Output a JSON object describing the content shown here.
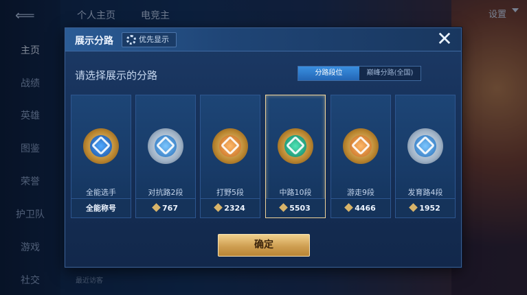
{
  "background": {
    "nav_items": [
      "主页",
      "战绩",
      "英雄",
      "图鉴",
      "荣誉",
      "护卫队",
      "游戏",
      "社交"
    ],
    "top_tabs": [
      "个人主页",
      "电竞主"
    ],
    "settings_label": "设置",
    "recent_visitors_label": "最近访客"
  },
  "modal": {
    "title": "展示分路",
    "priority_button_label": "优先显示",
    "close_label": "✕",
    "subtitle": "请选择展示的分路",
    "toggle": {
      "left": "分路段位",
      "right": "巅峰分路(全国)",
      "selected": "left"
    },
    "cards": [
      {
        "label": "全能选手",
        "footer": "全能称号",
        "show_icon": false,
        "selected": false
      },
      {
        "label": "对抗路2段",
        "footer": "767",
        "show_icon": true,
        "selected": false
      },
      {
        "label": "打野5段",
        "footer": "2324",
        "show_icon": true,
        "selected": false
      },
      {
        "label": "中路10段",
        "footer": "5503",
        "show_icon": true,
        "selected": true
      },
      {
        "label": "游走9段",
        "footer": "4466",
        "show_icon": true,
        "selected": false
      },
      {
        "label": "发育路4段",
        "footer": "1952",
        "show_icon": true,
        "selected": false
      }
    ],
    "confirm_label": "确定"
  },
  "icons": {
    "close": "close-icon",
    "gear": "gear-icon",
    "score": "score-icon"
  },
  "colors": {
    "accent_gold": "#f0d08c",
    "toggle_active": "#2f7fd4"
  }
}
